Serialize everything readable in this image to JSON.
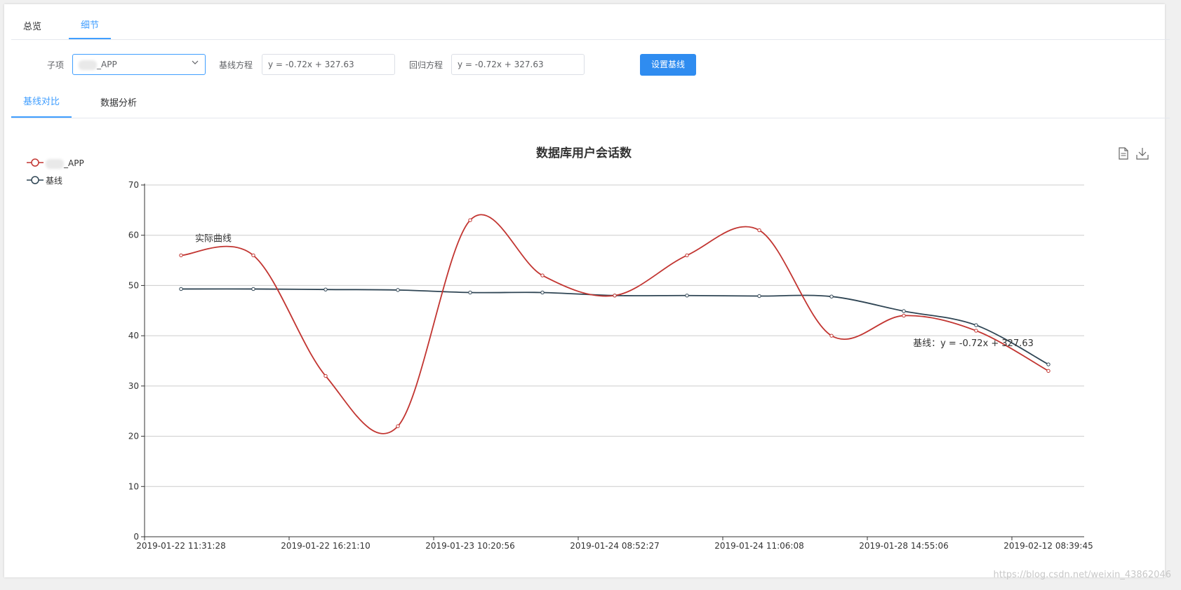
{
  "tabs_top": [
    "总览",
    "细节"
  ],
  "tabs_sub": [
    "基线对比",
    "数据分析"
  ],
  "form": {
    "subitem_label": "子项",
    "subitem_value": "_APP",
    "baseline_label": "基线方程",
    "baseline_value": "y = -0.72x + 327.63",
    "regression_label": "回归方程",
    "regression_value": "y = -0.72x + 327.63",
    "set_button": "设置基线"
  },
  "watermark": "https://blog.csdn.net/weixin_43862046",
  "chart_data": {
    "type": "line",
    "title": "数据库用户会话数",
    "categories": [
      "2019-01-22 11:31:28",
      "",
      "2019-01-22 16:21:10",
      "",
      "2019-01-23 10:20:56",
      "",
      "2019-01-24 08:52:27",
      "",
      "2019-01-24 11:06:08",
      "",
      "2019-01-28 14:55:06",
      "",
      "2019-02-12 08:39:45"
    ],
    "series": [
      {
        "name": "_APP",
        "color": "#c23531",
        "values": [
          56,
          56,
          32,
          22,
          63,
          52,
          48,
          56,
          61,
          40,
          44,
          41,
          33
        ]
      },
      {
        "name": "基线",
        "color": "#2f4554",
        "values": [
          49.3,
          49.3,
          49.2,
          49.1,
          48.6,
          48.6,
          48.0,
          48.0,
          47.9,
          47.8,
          44.9,
          42.1,
          34.3
        ]
      }
    ],
    "ylim": [
      0,
      70
    ],
    "yticks": [
      0,
      10,
      20,
      30,
      40,
      50,
      60,
      70
    ],
    "grid": true,
    "legend_position": "top-left",
    "annotations": [
      {
        "text": "实际曲线",
        "series": 0,
        "index": 0
      },
      {
        "text": "基线：y = -0.72x + 327.63",
        "series": 1,
        "index": 11
      }
    ]
  }
}
